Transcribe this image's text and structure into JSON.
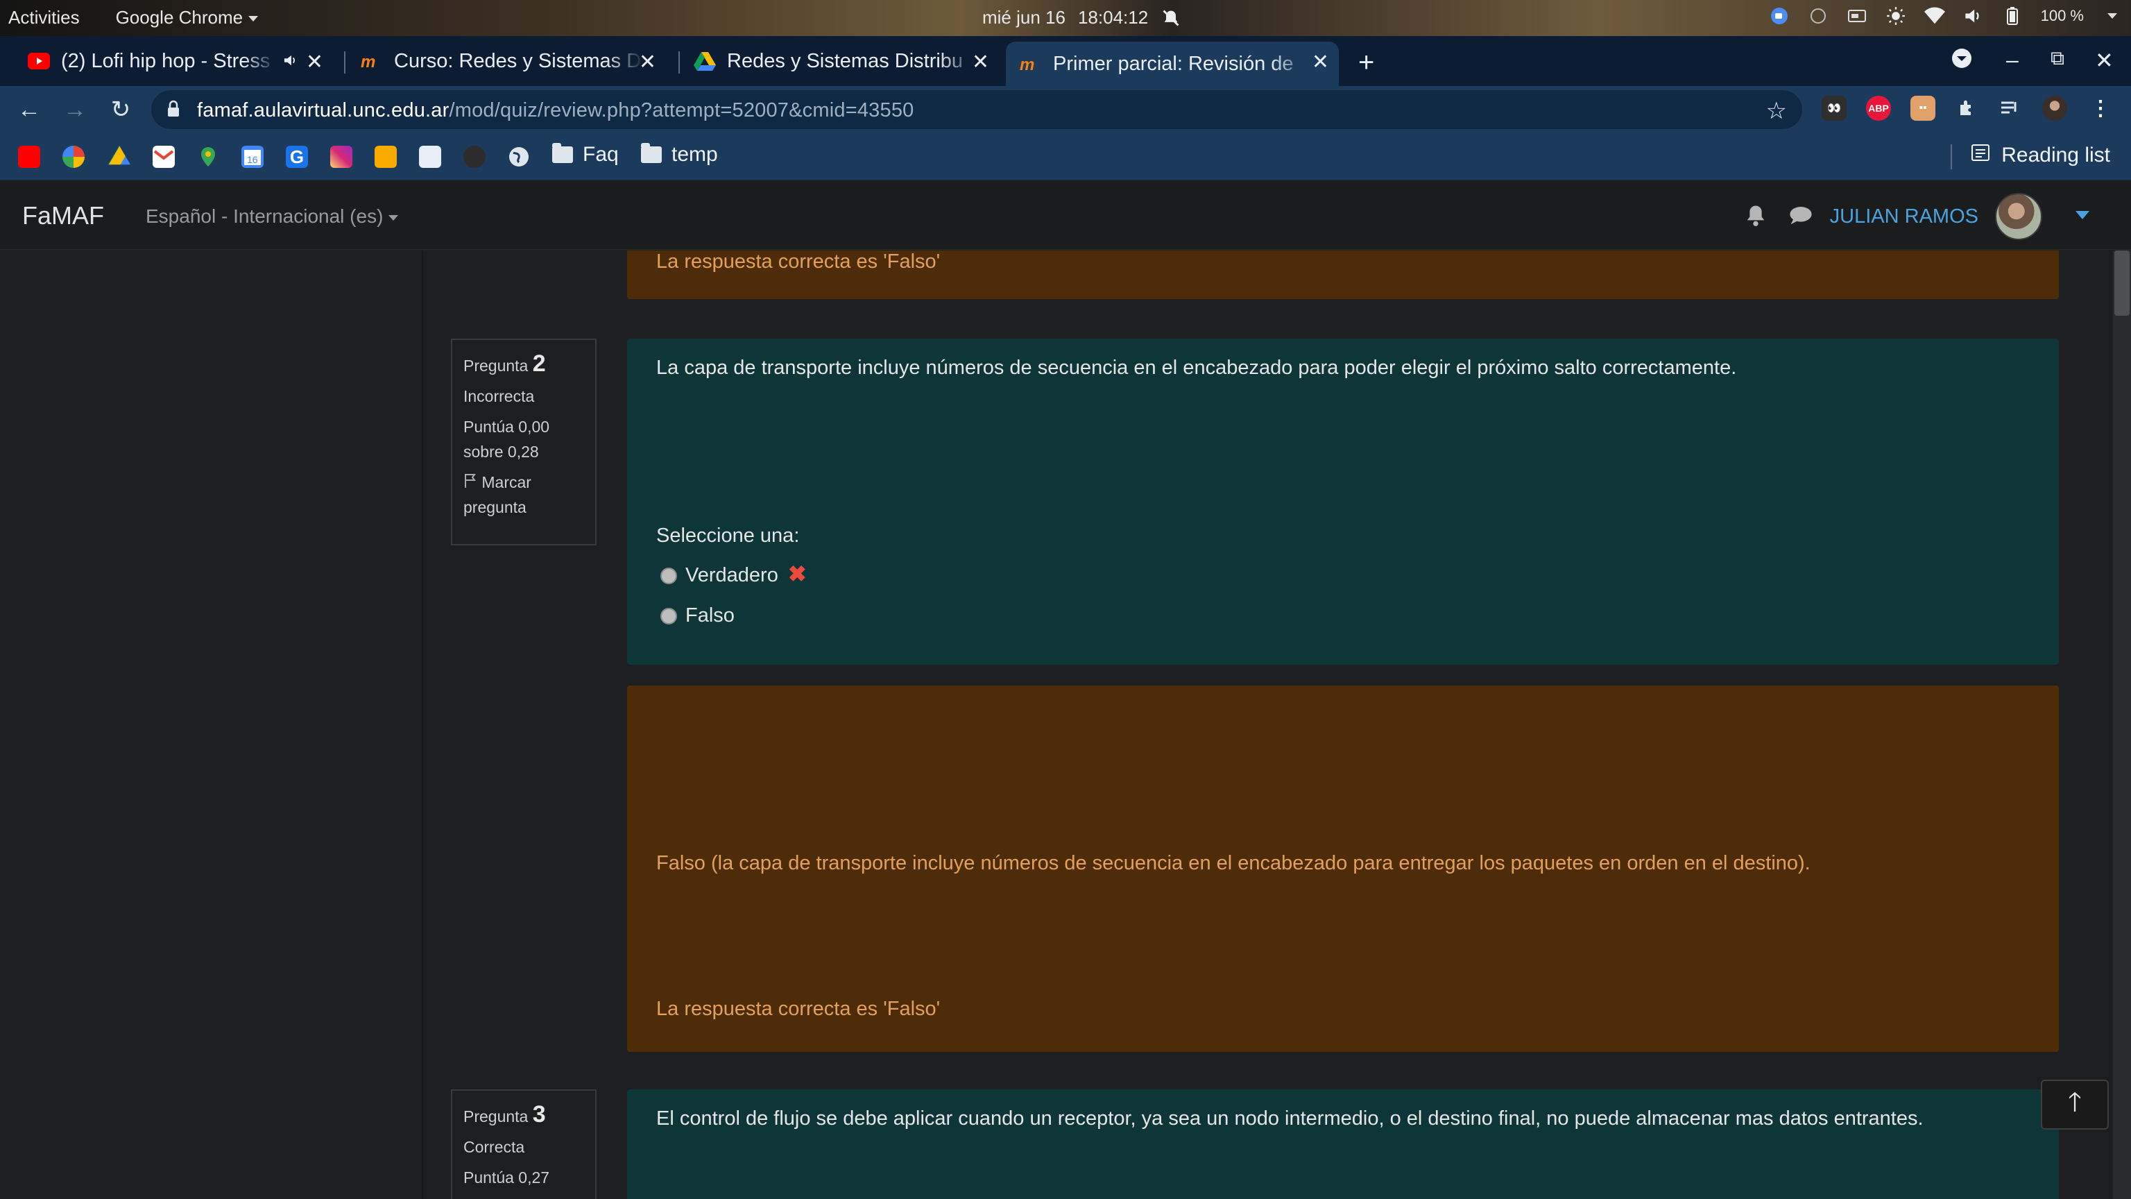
{
  "system_bar": {
    "activities": "Activities",
    "app_name": "Google Chrome",
    "date": "mié jun 16",
    "time": "18:04:12",
    "battery": "100 %"
  },
  "tabs": [
    {
      "title": "(2) Lofi hip hop - Stress",
      "favicon": "youtube-icon",
      "audio": true
    },
    {
      "title": "Curso: Redes y Sistemas D",
      "favicon": "moodle-icon"
    },
    {
      "title": "Redes y Sistemas Distribu",
      "favicon": "google-drive-icon"
    },
    {
      "title": "Primer parcial: Revisión de",
      "favicon": "moodle-icon",
      "active": true
    }
  ],
  "address_bar": {
    "host": "famaf.aulavirtual.unc.edu.ar",
    "path": "/mod/quiz/review.php?attempt=52007&cmid=43550"
  },
  "bookmarks": {
    "folders": [
      "Faq",
      "temp"
    ],
    "reading_list": "Reading list"
  },
  "moodle_nav": {
    "brand": "FaMAF",
    "language": "Español - Internacional (es)",
    "user": "JULIAN RAMOS"
  },
  "prev_feedback": {
    "correct_answer": "La respuesta correcta es 'Falso'"
  },
  "question2": {
    "label": "Pregunta",
    "number": "2",
    "state": "Incorrecta",
    "grade": "Puntúa 0,00 sobre 0,28",
    "flag": "Marcar pregunta",
    "text": "La capa de transporte incluye números de secuencia en el encabezado para poder elegir el próximo salto correctamente.",
    "prompt": "Seleccione una:",
    "options": [
      "Verdadero",
      "Falso"
    ],
    "feedback": "Falso (la capa de transporte incluye números de secuencia en el encabezado para entregar los paquetes en orden en el destino).",
    "correct_answer": "La respuesta correcta es 'Falso'"
  },
  "question3": {
    "label": "Pregunta",
    "number": "3",
    "state": "Correcta",
    "grade": "Puntúa 0,27",
    "text": "El control de flujo se debe aplicar cuando un receptor, ya sea un nodo intermedio, o el destino final, no puede almacenar mas datos entrantes."
  }
}
